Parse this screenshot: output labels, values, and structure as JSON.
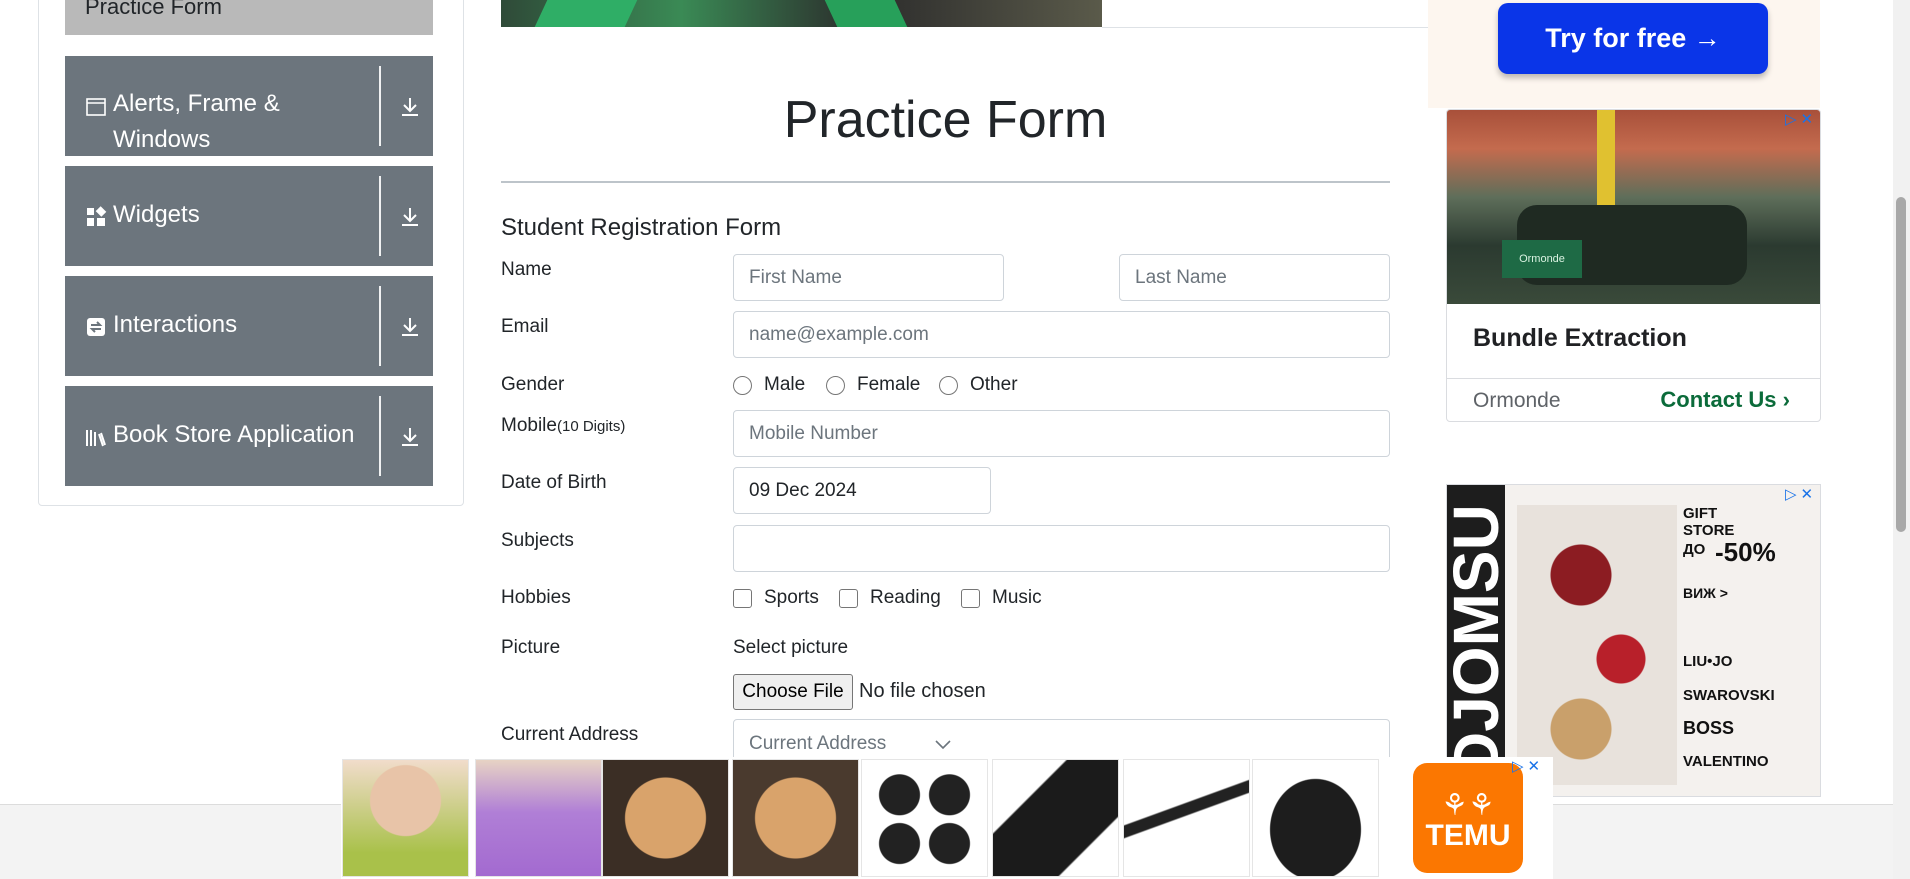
{
  "sidebar": {
    "top_item": "Practice Form",
    "groups": [
      {
        "label": "Alerts, Frame & Windows",
        "icon": "window-icon"
      },
      {
        "label": "Widgets",
        "icon": "widgets-icon"
      },
      {
        "label": "Interactions",
        "icon": "interactions-icon"
      },
      {
        "label": "Book Store Application",
        "icon": "books-icon"
      }
    ]
  },
  "page": {
    "title": "Practice Form",
    "form_heading": "Student Registration Form"
  },
  "form": {
    "name_label": "Name",
    "first_name_placeholder": "First Name",
    "last_name_placeholder": "Last Name",
    "email_label": "Email",
    "email_placeholder": "name@example.com",
    "gender_label": "Gender",
    "gender_options": [
      "Male",
      "Female",
      "Other"
    ],
    "mobile_label": "Mobile",
    "mobile_hint": "(10 Digits)",
    "mobile_placeholder": "Mobile Number",
    "dob_label": "Date of Birth",
    "dob_value": "09 Dec 2024",
    "subjects_label": "Subjects",
    "hobbies_label": "Hobbies",
    "hobbies_options": [
      "Sports",
      "Reading",
      "Music"
    ],
    "picture_label": "Picture",
    "select_picture": "Select picture",
    "choose_file": "Choose File",
    "no_file": "No file chosen",
    "address_label": "Current Address",
    "address_placeholder": "Current Address"
  },
  "ads": {
    "try_free": "Try for free →",
    "bundle_headline": "Bundle Extraction",
    "bundle_brand": "Ormonde",
    "bundle_cta": "Contact Us",
    "djo_brand": "DJOMSU",
    "djo_lines": [
      "GIFT",
      "STORE",
      "ДО",
      "-50%",
      "ВИЖ >",
      "LIU•JO",
      "SWAROVSKI",
      "BOSS",
      "VALENTINO"
    ],
    "temu_logo": "TEMU"
  },
  "colors": {
    "sidebar_group": "#6c757d",
    "try_button": "#0a35e8",
    "contact_green": "#0b6b3a",
    "temu_orange": "#fb7701"
  }
}
